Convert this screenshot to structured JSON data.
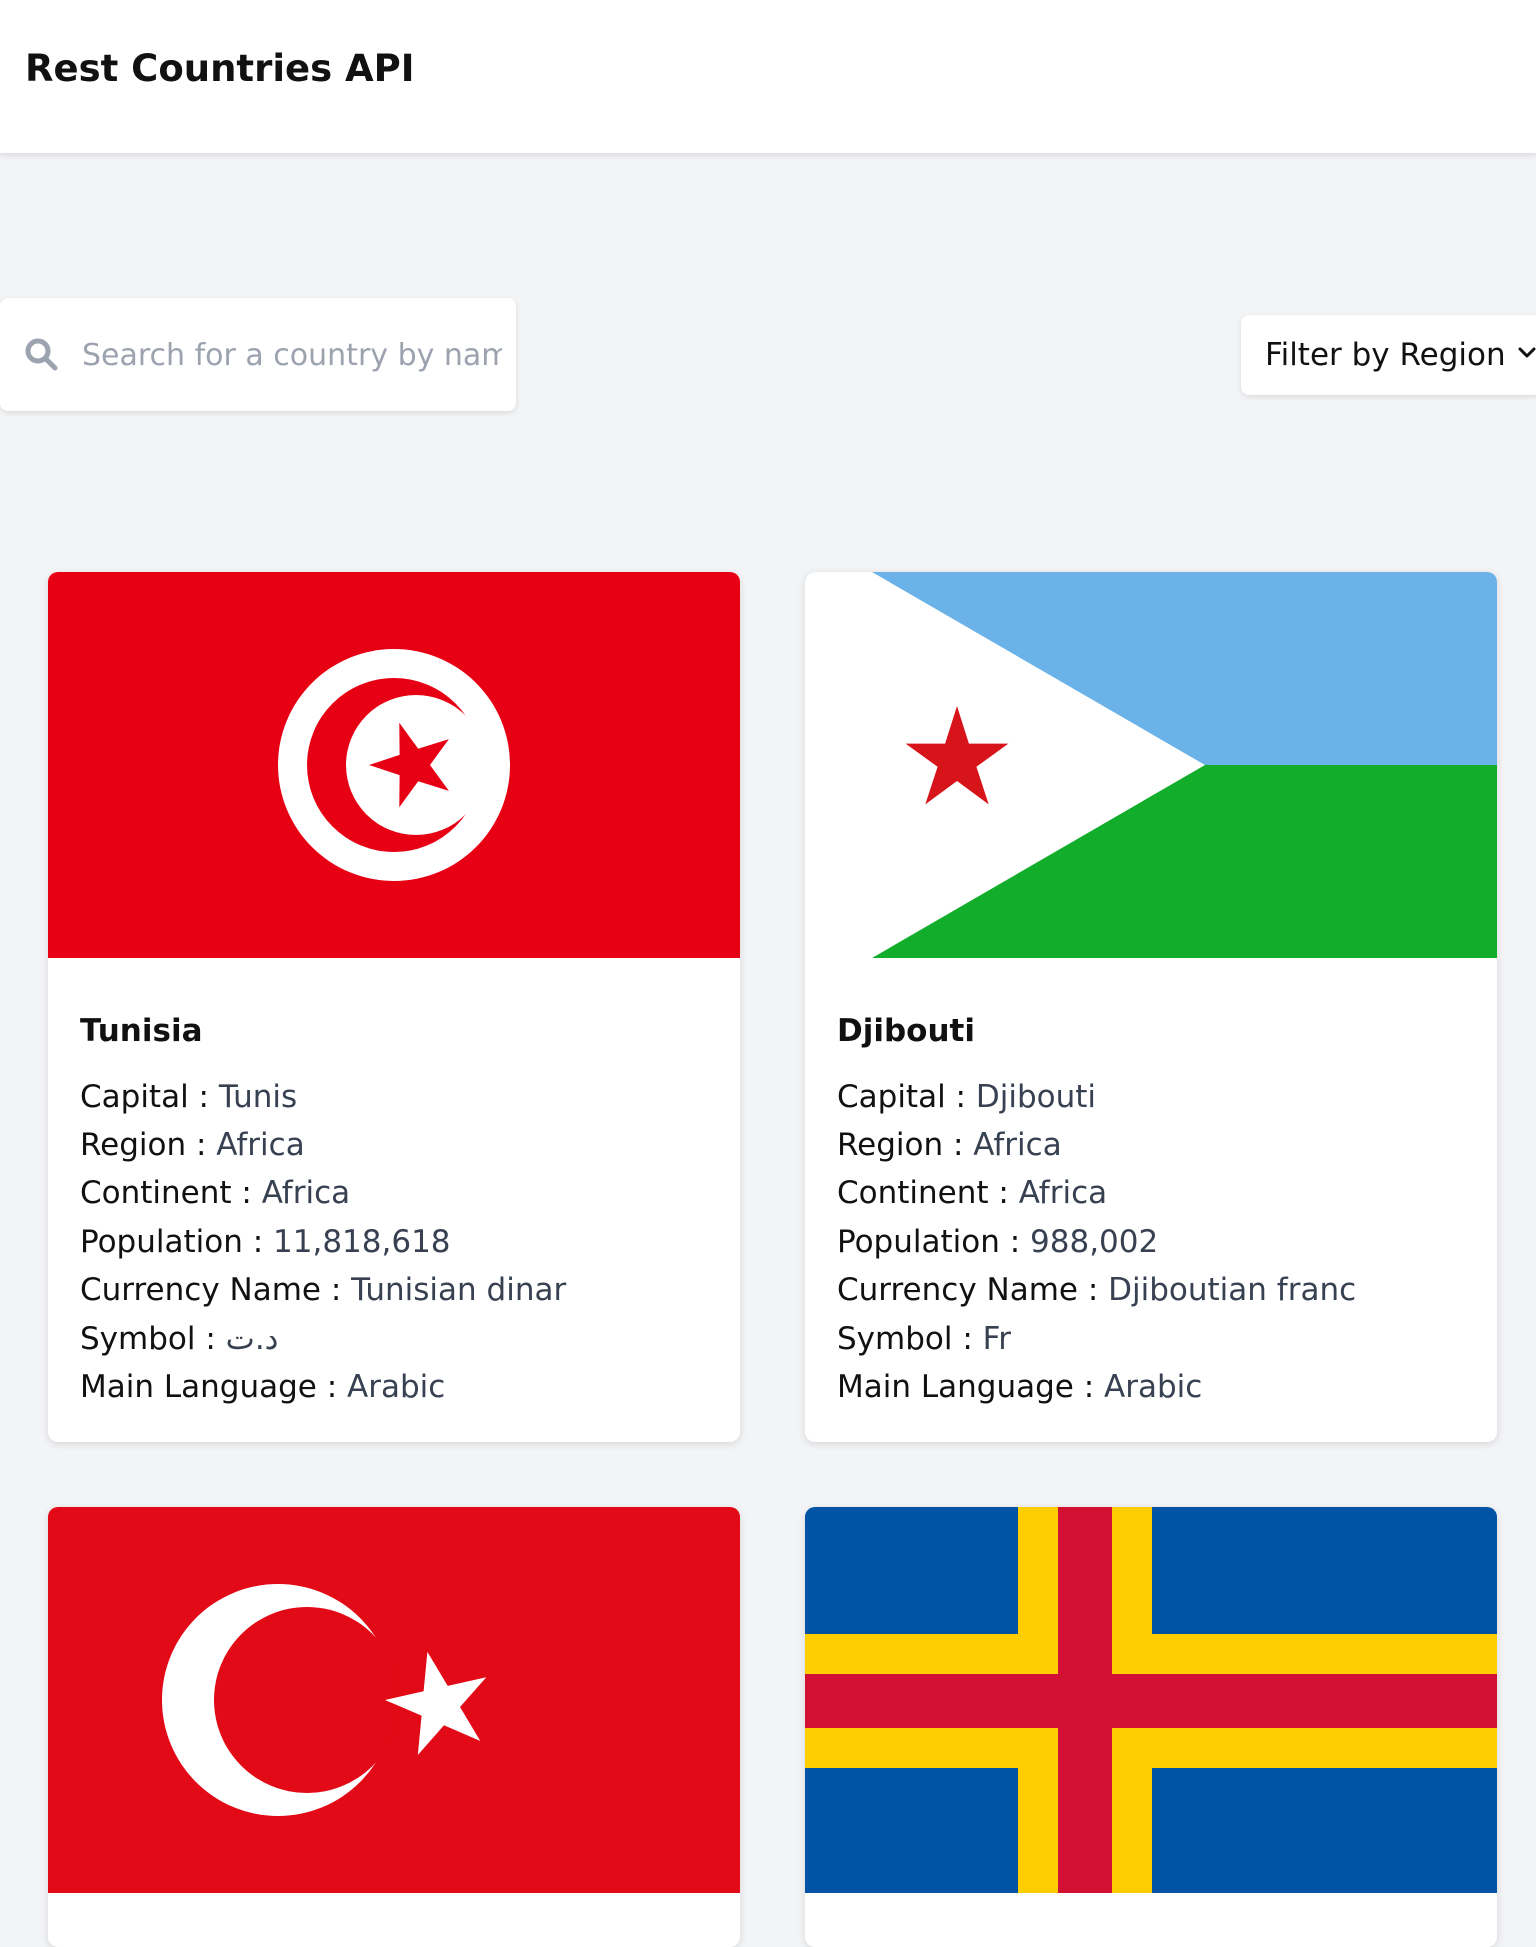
{
  "header": {
    "title": "Rest Countries API"
  },
  "search": {
    "placeholder": "Search for a country by name",
    "value": ""
  },
  "filter": {
    "label": "Filter by Region"
  },
  "field_labels": {
    "capital": "Capital : ",
    "region": "Region : ",
    "continent": "Continent : ",
    "population": "Population : ",
    "currency": "Currency Name : ",
    "symbol": "Symbol : ",
    "language": "Main Language : "
  },
  "countries": [
    {
      "name": "Tunisia",
      "capital": "Tunis",
      "region": "Africa",
      "continent": "Africa",
      "population": "11,818,618",
      "currency": "Tunisian dinar",
      "symbol": "د.ت",
      "language": "Arabic",
      "flag_icon": "tunisia-flag"
    },
    {
      "name": "Djibouti",
      "capital": "Djibouti",
      "region": "Africa",
      "continent": "Africa",
      "population": "988,002",
      "currency": "Djiboutian franc",
      "symbol": "Fr",
      "language": "Arabic",
      "flag_icon": "djibouti-flag"
    },
    {
      "flag_icon": "turkey-flag"
    },
    {
      "flag_icon": "aland-islands-flag"
    }
  ],
  "colors": {
    "background": "#f3f4f6",
    "tunisia_red": "#e70013",
    "djibouti_blue": "#6ab2e7",
    "djibouti_green": "#12ad2b",
    "turkey_red": "#e30a17",
    "aland_blue": "#0053a5",
    "aland_yellow": "#ffce00",
    "aland_red": "#d21034"
  }
}
